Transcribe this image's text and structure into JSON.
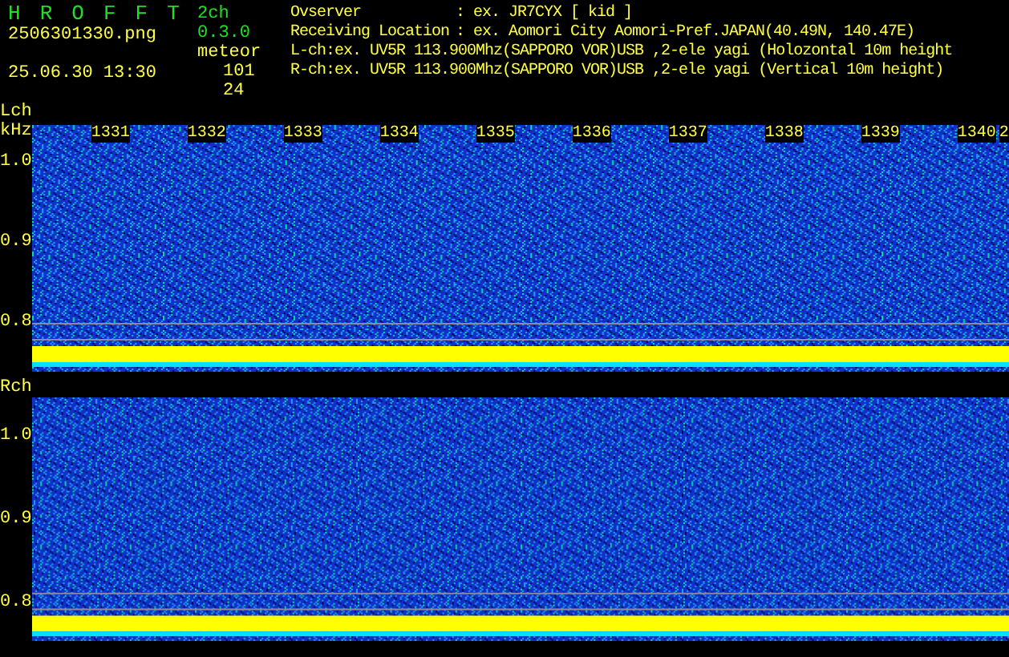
{
  "header": {
    "app_letters": [
      "H",
      "R",
      "O",
      "F",
      "F",
      "T"
    ],
    "version": "2ch 0.3.0",
    "file_name": "2506301330.png",
    "timestamp": "25.06.30 13:30",
    "mode": "meteor",
    "counts": [
      "101",
      "24"
    ],
    "info": [
      {
        "label": "Ovserver",
        "value": ": ex. JR7CYX [ kid ]"
      },
      {
        "label": "Receiving Location",
        "value": ": ex. Aomori City Aomori-Pref.JAPAN(40.49N, 140.47E)"
      },
      {
        "label": "L-ch:",
        "value": "ex. UV5R 113.900Mhz(SAPPORO VOR)USB ,2-ele yagi (Holozontal 10m height"
      },
      {
        "label": "R-ch:",
        "value": "ex. UV5R 113.900Mhz(SAPPORO VOR)USB ,2-ele yagi (Vertical 10m height)"
      }
    ]
  },
  "panels": [
    {
      "channel": "Lch",
      "unit": "kHz",
      "time_labels": [
        "1331",
        "1332",
        "1333",
        "1334",
        "1335",
        "1336",
        "1337",
        "1338",
        "1339",
        "1340",
        "2"
      ],
      "freq_labels": [
        "1.0",
        "0.9",
        "0.8"
      ]
    },
    {
      "channel": "Rch",
      "freq_labels": [
        "1.0",
        "0.9",
        "0.8"
      ]
    }
  ]
}
